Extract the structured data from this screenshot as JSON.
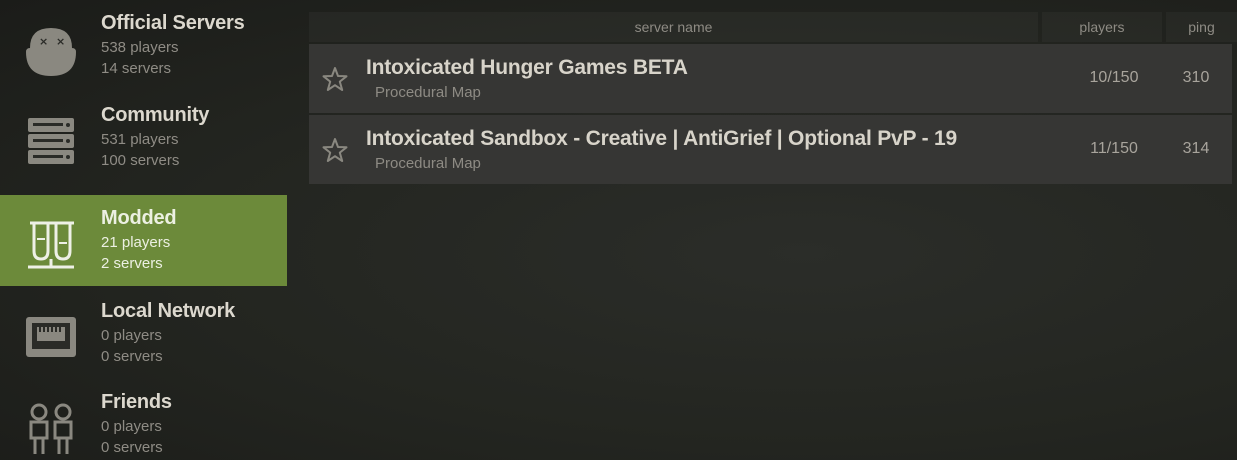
{
  "sidebar": {
    "categories": [
      {
        "title": "Official Servers",
        "players": "538 players",
        "servers": "14 servers",
        "icon": "official-servers-icon"
      },
      {
        "title": "Community",
        "players": "531 players",
        "servers": "100 servers",
        "icon": "server-rack-icon"
      },
      {
        "title": "Modded",
        "players": "21 players",
        "servers": "2 servers",
        "icon": "test-tubes-icon",
        "active": true
      },
      {
        "title": "Local Network",
        "players": "0 players",
        "servers": "0 servers",
        "icon": "network-port-icon"
      },
      {
        "title": "Friends",
        "players": "0 players",
        "servers": "0 servers",
        "icon": "friends-icon"
      }
    ]
  },
  "list": {
    "headers": {
      "name": "server name",
      "players": "players",
      "ping": "ping"
    },
    "rows": [
      {
        "name": "Intoxicated Hunger Games BETA",
        "map": "Procedural Map",
        "players": "10/150",
        "ping": "310"
      },
      {
        "name": "Intoxicated Sandbox - Creative | AntiGrief | Optional PvP - 19",
        "map": "Procedural Map",
        "players": "11/150",
        "ping": "314"
      }
    ]
  },
  "colors": {
    "accent": "#6c8a3a",
    "row_bg": "#363634",
    "background": "#232520"
  }
}
